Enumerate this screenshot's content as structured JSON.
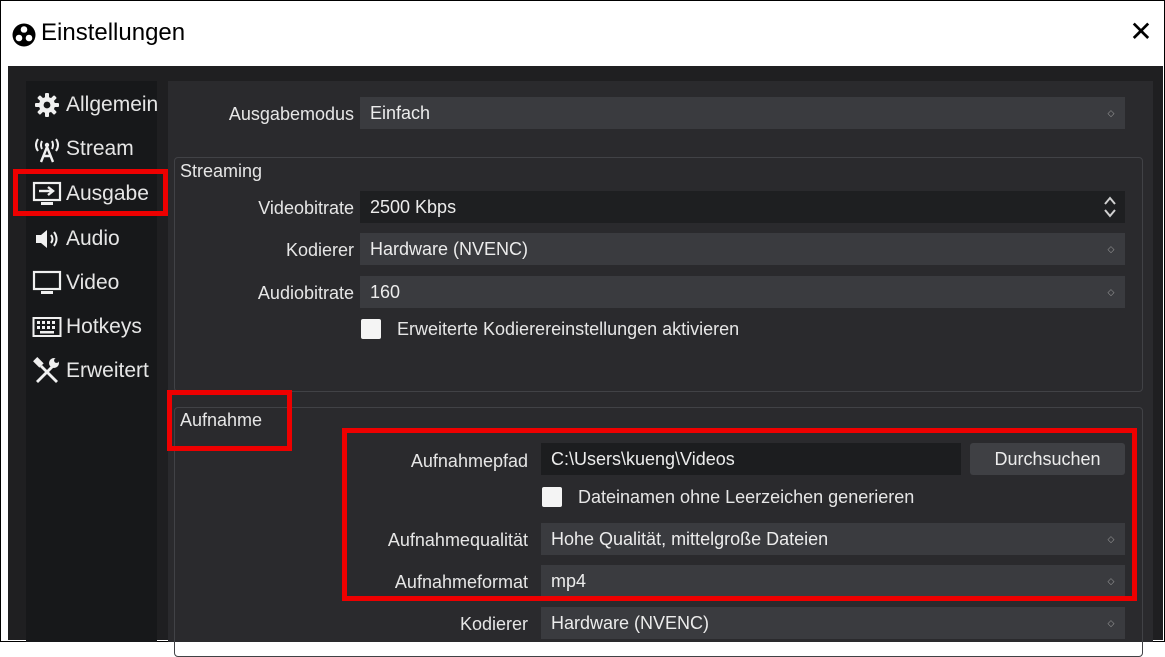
{
  "window": {
    "title": "Einstellungen",
    "close_glyph": "✕"
  },
  "sidebar": {
    "items": [
      {
        "label": "Allgemein",
        "icon": "gear-icon"
      },
      {
        "label": "Stream",
        "icon": "antenna-icon"
      },
      {
        "label": "Ausgabe",
        "icon": "output-icon"
      },
      {
        "label": "Audio",
        "icon": "speaker-icon"
      },
      {
        "label": "Video",
        "icon": "monitor-icon"
      },
      {
        "label": "Hotkeys",
        "icon": "keyboard-icon"
      },
      {
        "label": "Erweitert",
        "icon": "tools-icon"
      }
    ]
  },
  "output": {
    "mode_label": "Ausgabemodus",
    "mode_value": "Einfach",
    "streaming": {
      "title": "Streaming",
      "video_bitrate_label": "Videobitrate",
      "video_bitrate_value": "2500 Kbps",
      "encoder_label": "Kodierer",
      "encoder_value": "Hardware (NVENC)",
      "audio_bitrate_label": "Audiobitrate",
      "audio_bitrate_value": "160",
      "advanced_checkbox_label": "Erweiterte Kodierereinstellungen aktivieren",
      "advanced_checked": false
    },
    "recording": {
      "title": "Aufnahme",
      "path_label": "Aufnahmepfad",
      "path_value": "C:\\Users\\kueng\\Videos",
      "browse_label": "Durchsuchen",
      "no_spaces_label": "Dateinamen ohne Leerzeichen generieren",
      "no_spaces_checked": false,
      "quality_label": "Aufnahmequalität",
      "quality_value": "Hohe Qualität, mittelgroße Dateien",
      "format_label": "Aufnahmeformat",
      "format_value": "mp4",
      "encoder_label": "Kodierer",
      "encoder_value": "Hardware (NVENC)"
    }
  },
  "colors": {
    "highlight": "#ee0000",
    "panel": "#2a2a2d",
    "sidebar": "#17181a",
    "field": "#3a3b3f"
  }
}
